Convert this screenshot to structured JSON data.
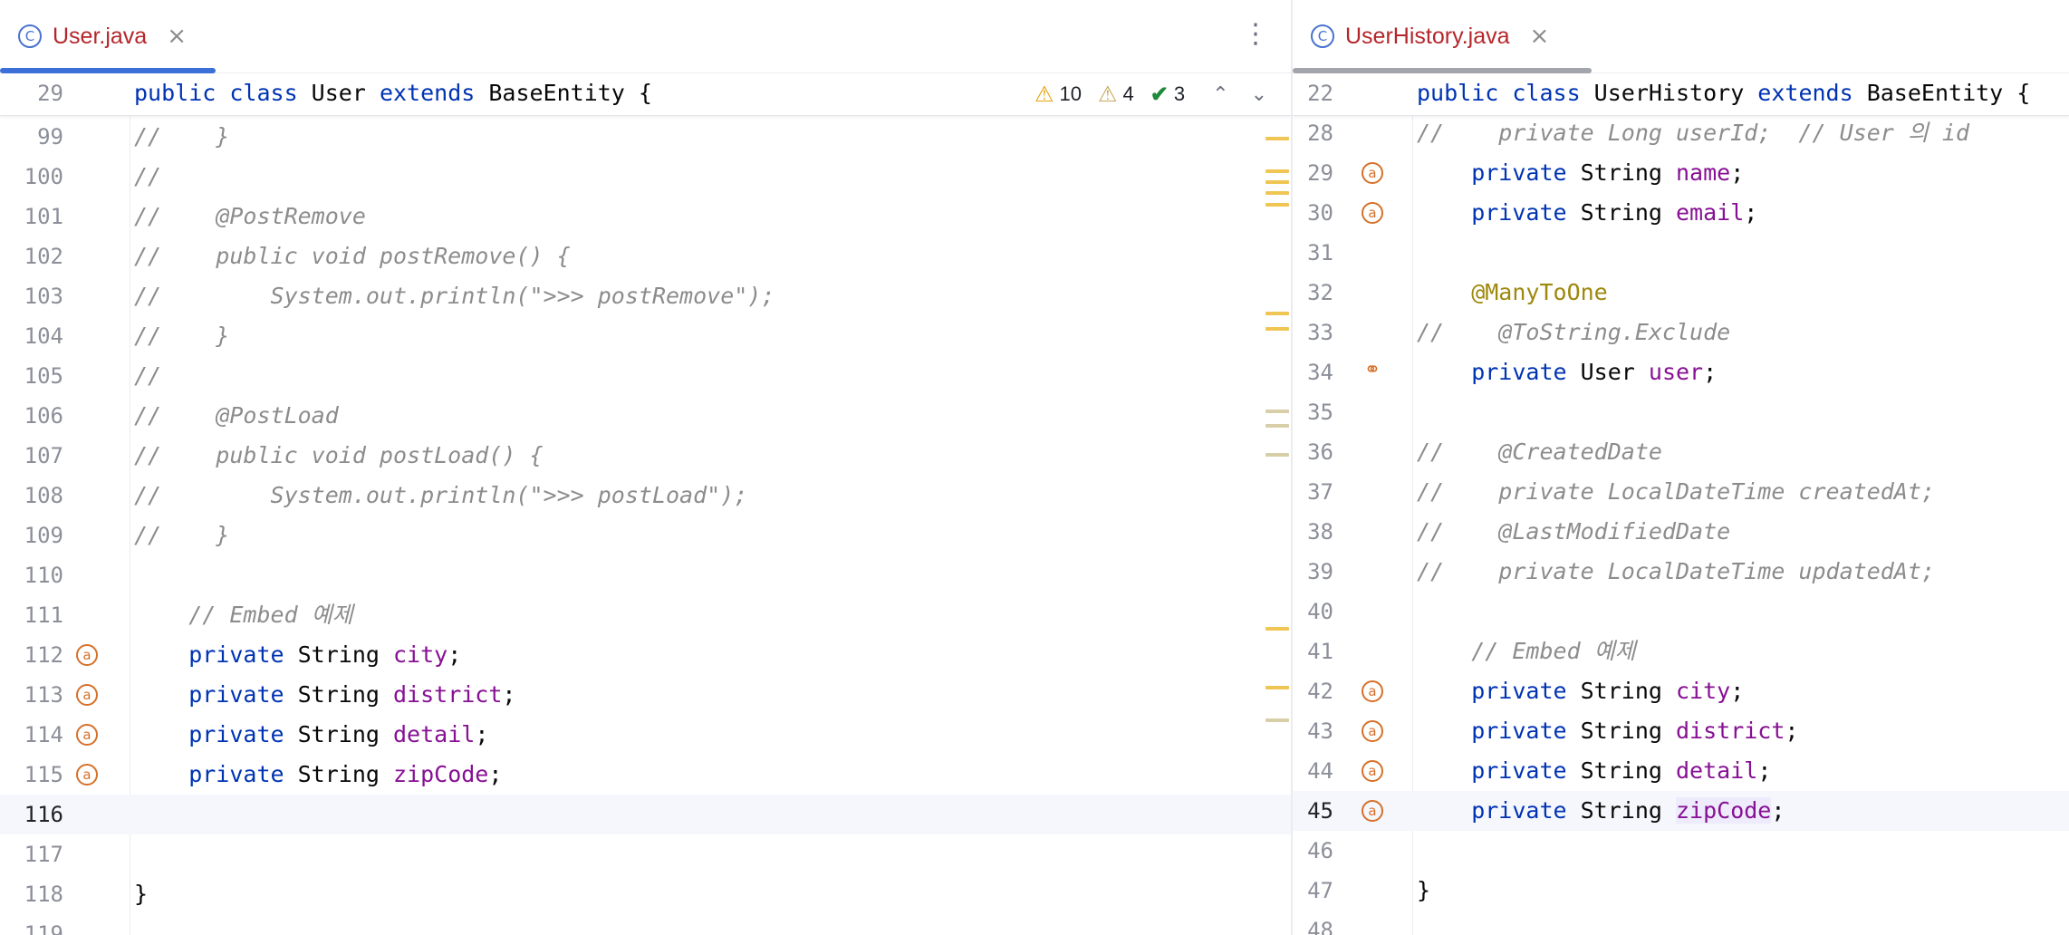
{
  "colors": {
    "keyword": "#0033b3",
    "field": "#871094",
    "annotation": "#9e880d",
    "comment": "#8c8c8c",
    "tab_label": "#b5262b",
    "gutter_icon": "#d6702a"
  },
  "left_pane": {
    "tab": {
      "icon": "class-icon",
      "icon_glyph": "C",
      "label": "User.java",
      "close": "×"
    },
    "menu_glyph": "⋮",
    "sticky_line": {
      "num": "29",
      "text": "public class User extends BaseEntity {"
    },
    "inspections": {
      "warnings": "10",
      "weak_warnings": "4",
      "typos": "3",
      "warn_glyph": "⚠",
      "ok_glyph": "✔",
      "up": "⌃",
      "down": "⌄"
    },
    "lines": [
      {
        "num": "99",
        "text": "//    }"
      },
      {
        "num": "100",
        "text": "//"
      },
      {
        "num": "101",
        "text": "//    @PostRemove"
      },
      {
        "num": "102",
        "text": "//    public void postRemove() {"
      },
      {
        "num": "103",
        "text": "//        System.out.println(\">>> postRemove\");"
      },
      {
        "num": "104",
        "text": "//    }"
      },
      {
        "num": "105",
        "text": "//"
      },
      {
        "num": "106",
        "text": "//    @PostLoad"
      },
      {
        "num": "107",
        "text": "//    public void postLoad() {"
      },
      {
        "num": "108",
        "text": "//        System.out.println(\">>> postLoad\");"
      },
      {
        "num": "109",
        "text": "//    }"
      },
      {
        "num": "110",
        "text": ""
      },
      {
        "num": "111",
        "text": "    // Embed 예제"
      },
      {
        "num": "112",
        "kw": "    private",
        "type": " String ",
        "field": "city",
        "end": ";"
      },
      {
        "num": "113",
        "kw": "    private",
        "type": " String ",
        "field": "district",
        "end": ";"
      },
      {
        "num": "114",
        "kw": "    private",
        "type": " String ",
        "field": "detail",
        "end": ";"
      },
      {
        "num": "115",
        "kw": "    private",
        "type": " String ",
        "field": "zipCode",
        "end": ";"
      },
      {
        "num": "116",
        "text": ""
      },
      {
        "num": "117",
        "text": ""
      },
      {
        "num": "118",
        "text": "}"
      },
      {
        "num": "119",
        "text": ""
      }
    ],
    "gutter_glyph": "a"
  },
  "right_pane": {
    "tab": {
      "icon": "class-icon",
      "icon_glyph": "C",
      "label": "UserHistory.java",
      "close": "×"
    },
    "sticky_line": {
      "num": "22",
      "text": "public class UserHistory extends BaseEntity {"
    },
    "lines": [
      {
        "num": "28",
        "text": "//    private Long userId;  // User 의 id"
      },
      {
        "num": "29",
        "kw": "    private",
        "type": " String ",
        "field": "name",
        "end": ";"
      },
      {
        "num": "30",
        "kw": "    private",
        "type": " String ",
        "field": "email",
        "end": ";"
      },
      {
        "num": "31",
        "text": ""
      },
      {
        "num": "32",
        "text": "    @ManyToOne"
      },
      {
        "num": "33",
        "text": "//    @ToString.Exclude"
      },
      {
        "num": "34",
        "kw": "    private",
        "type": " User ",
        "field": "user",
        "end": ";"
      },
      {
        "num": "35",
        "text": ""
      },
      {
        "num": "36",
        "text": "//    @CreatedDate"
      },
      {
        "num": "37",
        "text": "//    private LocalDateTime createdAt;"
      },
      {
        "num": "38",
        "text": "//    @LastModifiedDate"
      },
      {
        "num": "39",
        "text": "//    private LocalDateTime updatedAt;"
      },
      {
        "num": "40",
        "text": ""
      },
      {
        "num": "41",
        "text": "    // Embed 예제"
      },
      {
        "num": "42",
        "kw": "    private",
        "type": " String ",
        "field": "city",
        "end": ";"
      },
      {
        "num": "43",
        "kw": "    private",
        "type": " String ",
        "field": "district",
        "end": ";"
      },
      {
        "num": "44",
        "kw": "    private",
        "type": " String ",
        "field": "detail",
        "end": ";"
      },
      {
        "num": "45",
        "kw": "    private",
        "type": " String ",
        "field": "zipCode",
        "end": ";"
      },
      {
        "num": "46",
        "text": ""
      },
      {
        "num": "47",
        "text": "}"
      },
      {
        "num": "48",
        "text": ""
      }
    ],
    "gutter_glyph": "a",
    "link_glyph": "⚭"
  }
}
